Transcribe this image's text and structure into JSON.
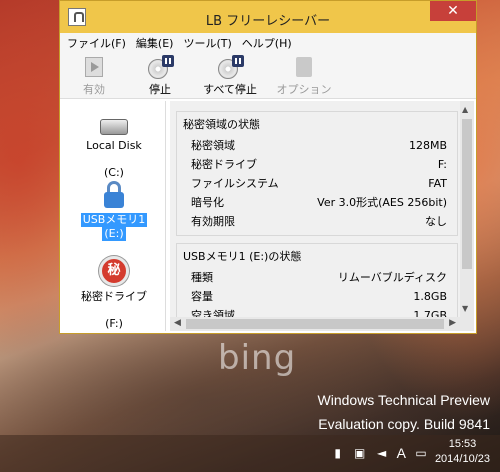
{
  "window": {
    "title": "LB フリーレシーバー",
    "close_glyph": "✕"
  },
  "menu": [
    "ファイル(F)",
    "編集(E)",
    "ツール(T)",
    "ヘルプ(H)"
  ],
  "toolbar": {
    "enable": "有効",
    "stop": "停止",
    "stop_all": "すべて停止",
    "options": "オプション"
  },
  "drives": [
    {
      "name": "Local Disk",
      "letter": "(C:)"
    },
    {
      "name": "USBメモリ1",
      "letter": "(E:)"
    },
    {
      "name": "秘密ドライブ",
      "letter": "(F:)"
    }
  ],
  "secret_icon_char": "秘",
  "status": {
    "title": "秘密領域の状態",
    "rows": [
      {
        "label": "秘密領域",
        "value": "128MB"
      },
      {
        "label": "秘密ドライブ",
        "value": "F:"
      },
      {
        "label": "ファイルシステム",
        "value": "FAT"
      },
      {
        "label": "暗号化",
        "value": "Ver 3.0形式(AES 256bit)"
      },
      {
        "label": "有効期限",
        "value": "なし"
      }
    ]
  },
  "usb_status": {
    "title": "USBメモリ1 (E:)の状態",
    "rows": [
      {
        "label": "種類",
        "value": "リムーバブルディスク"
      },
      {
        "label": "容量",
        "value": "1.8GB"
      },
      {
        "label": "空き領域",
        "value": "1.7GB"
      }
    ]
  },
  "desktop": {
    "bing": "bing",
    "watermark1": "Windows Technical Preview",
    "watermark2": "Evaluation copy. Build 9841"
  },
  "taskbar": {
    "ime": "A",
    "time": "15:53",
    "date": "2014/10/23"
  }
}
